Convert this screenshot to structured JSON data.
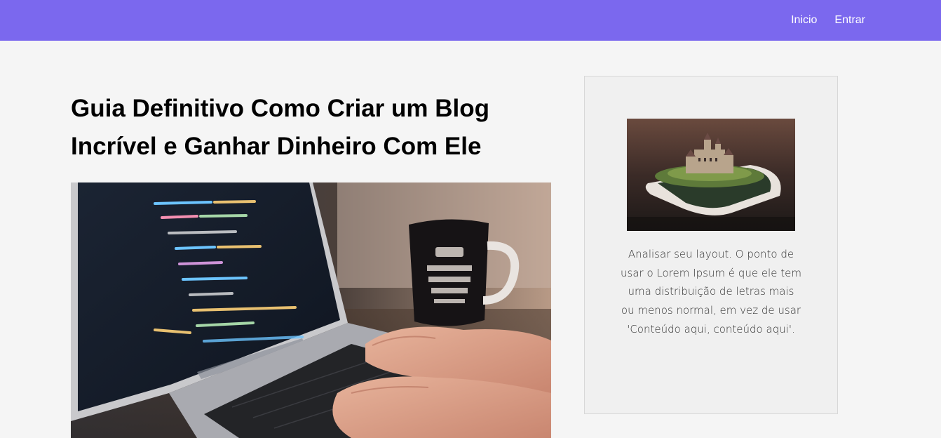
{
  "nav": {
    "items": [
      {
        "label": "Inicio"
      },
      {
        "label": "Entrar"
      }
    ]
  },
  "colors": {
    "header_bg": "#7b68ee",
    "page_bg": "#f5f5f5",
    "card_bg": "#f0f0f0"
  },
  "article": {
    "title": "Guia Definitivo Como Criar um Blog Incrível e Ganhar Dinheiro Com Ele",
    "image": "laptop-coding-coffee-photo"
  },
  "sidebar_card": {
    "image": "smartphone-castle-photo",
    "text": "Analisar seu layout. O ponto de usar o Lorem Ipsum é que ele tem uma distribuição de letras mais ou menos normal, em vez de usar 'Conteúdo aqui, conteúdo aqui'."
  }
}
